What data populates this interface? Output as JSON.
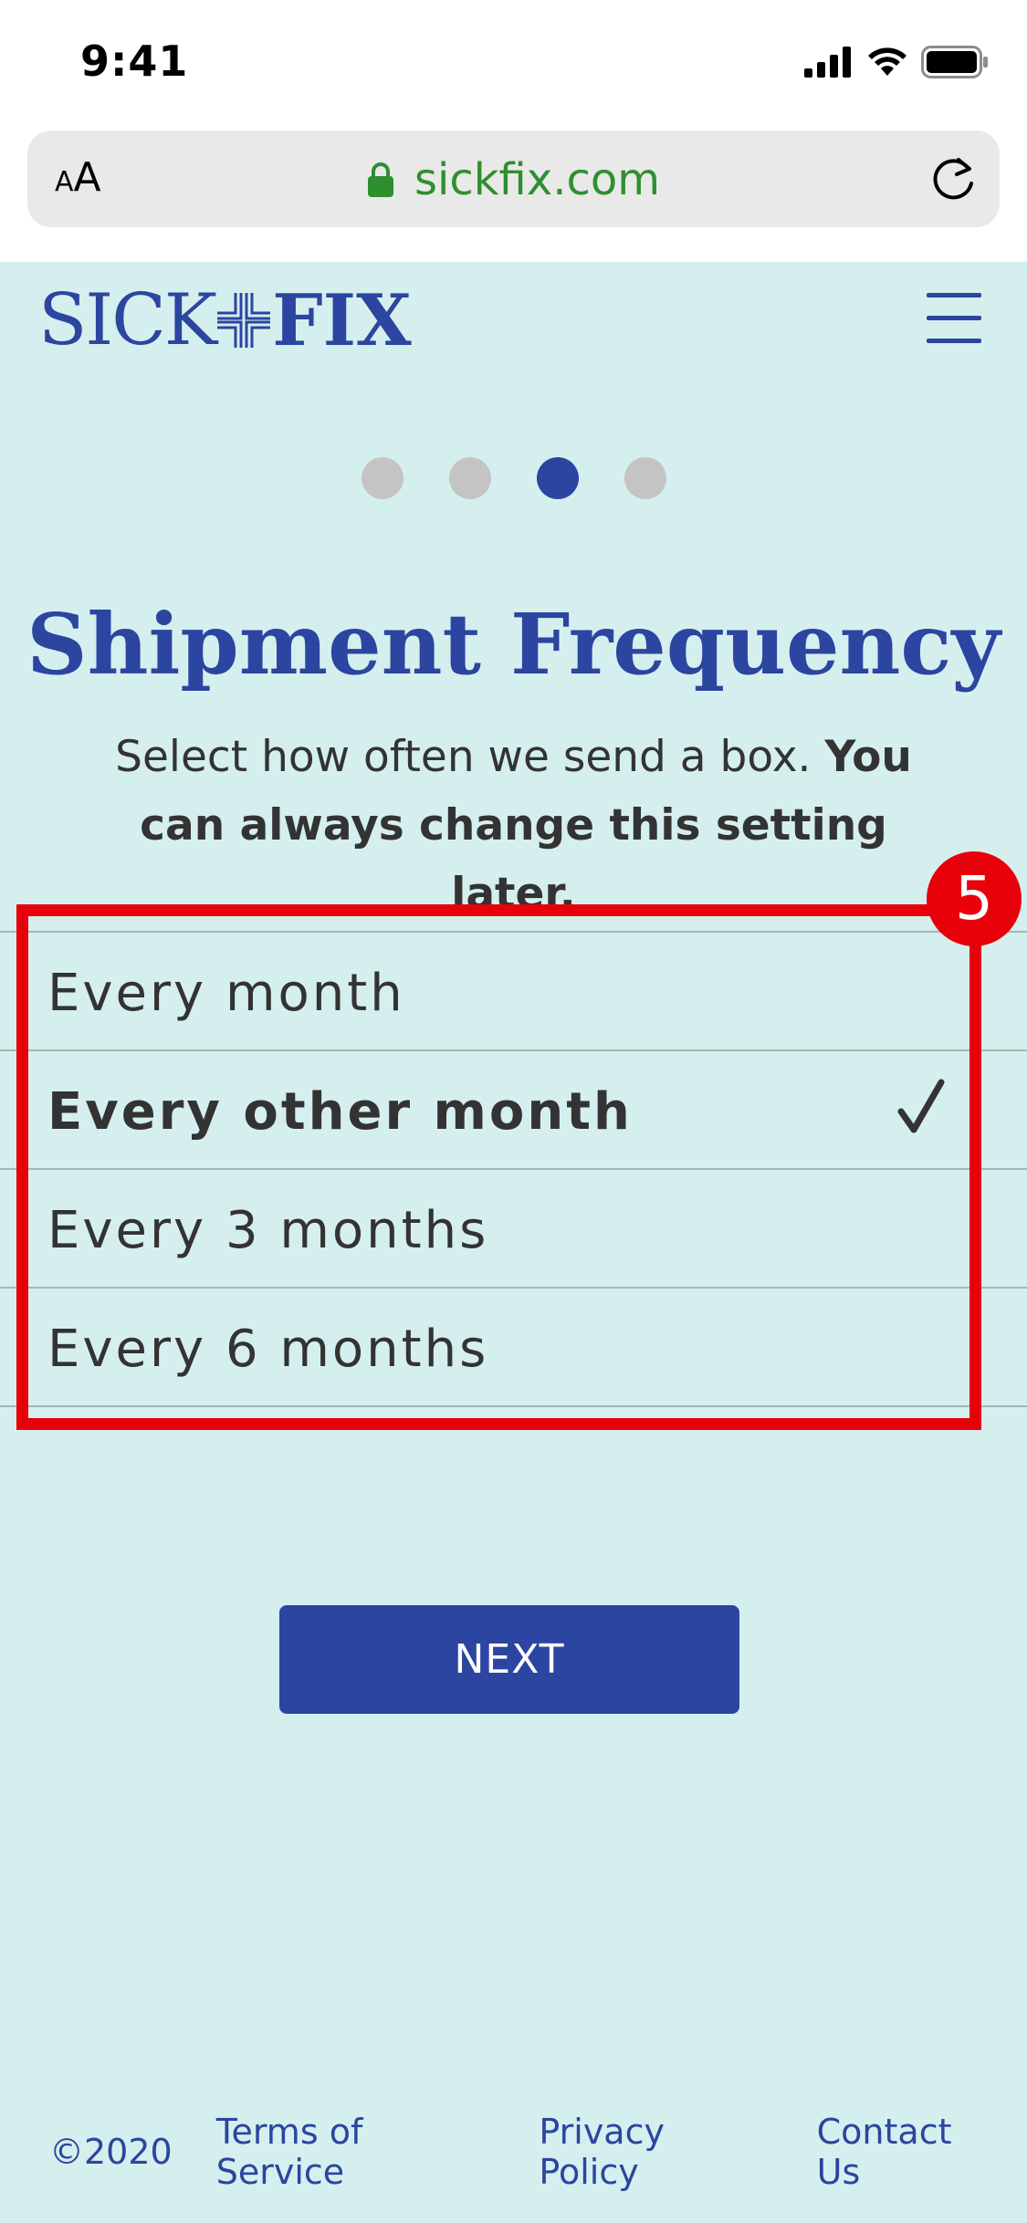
{
  "status_bar": {
    "time": "9:41"
  },
  "browser": {
    "text_size_small": "A",
    "text_size_large": "A",
    "url": "sickfix.com"
  },
  "site": {
    "logo_left": "SICK",
    "logo_right": "FIX"
  },
  "progress": {
    "total_steps": 4,
    "current_step": 3
  },
  "heading": {
    "title": "Shipment Frequency",
    "subtitle_plain": "Select how often we send a box. ",
    "subtitle_bold": "You can always change this setting later."
  },
  "options": [
    {
      "label": "Every month",
      "selected": false
    },
    {
      "label": "Every other month",
      "selected": true
    },
    {
      "label": "Every 3 months",
      "selected": false
    },
    {
      "label": "Every 6 months",
      "selected": false
    }
  ],
  "annotation": {
    "badge": "5"
  },
  "next_button": {
    "label": "NEXT"
  },
  "footer": {
    "copyright": "©2020",
    "links": [
      "Terms of Service",
      "Privacy Policy",
      "Contact Us"
    ]
  },
  "colors": {
    "brand": "#2b45a0",
    "page_bg": "#d5efee",
    "highlight": "#e8000b",
    "secure": "#2f8f2f"
  }
}
